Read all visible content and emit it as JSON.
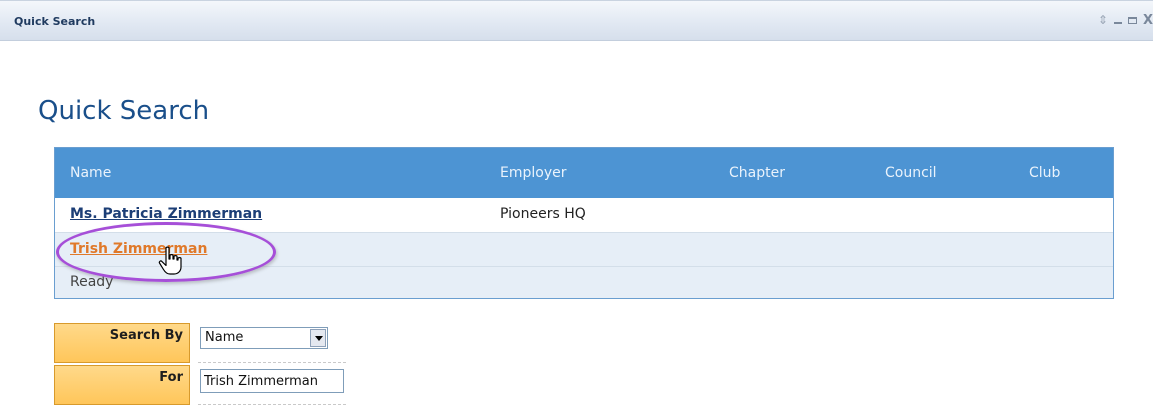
{
  "portlet": {
    "title": "Quick Search",
    "controls": {
      "updown": "⇕",
      "close": "X"
    }
  },
  "page_title": "Quick Search",
  "results": {
    "columns": [
      "Name",
      "Employer",
      "Chapter",
      "Council",
      "Club"
    ],
    "rows": [
      {
        "name": "Ms. Patricia Zimmerman",
        "employer": "Pioneers HQ",
        "chapter": "",
        "council": "",
        "club": ""
      },
      {
        "name": "Trish Zimmerman",
        "employer": "",
        "chapter": "",
        "council": "",
        "club": ""
      }
    ],
    "status": "Ready"
  },
  "form": {
    "search_by_label": "Search By",
    "search_by_value": "Name",
    "for_label": "For",
    "for_value": "Trish Zimmerman"
  },
  "colors": {
    "header_blue": "#4d94d3",
    "title_blue": "#1a4f8a",
    "visited_link": "#e0792a",
    "highlight_purple": "#a64fd8",
    "label_orange": "#ffc65a"
  }
}
